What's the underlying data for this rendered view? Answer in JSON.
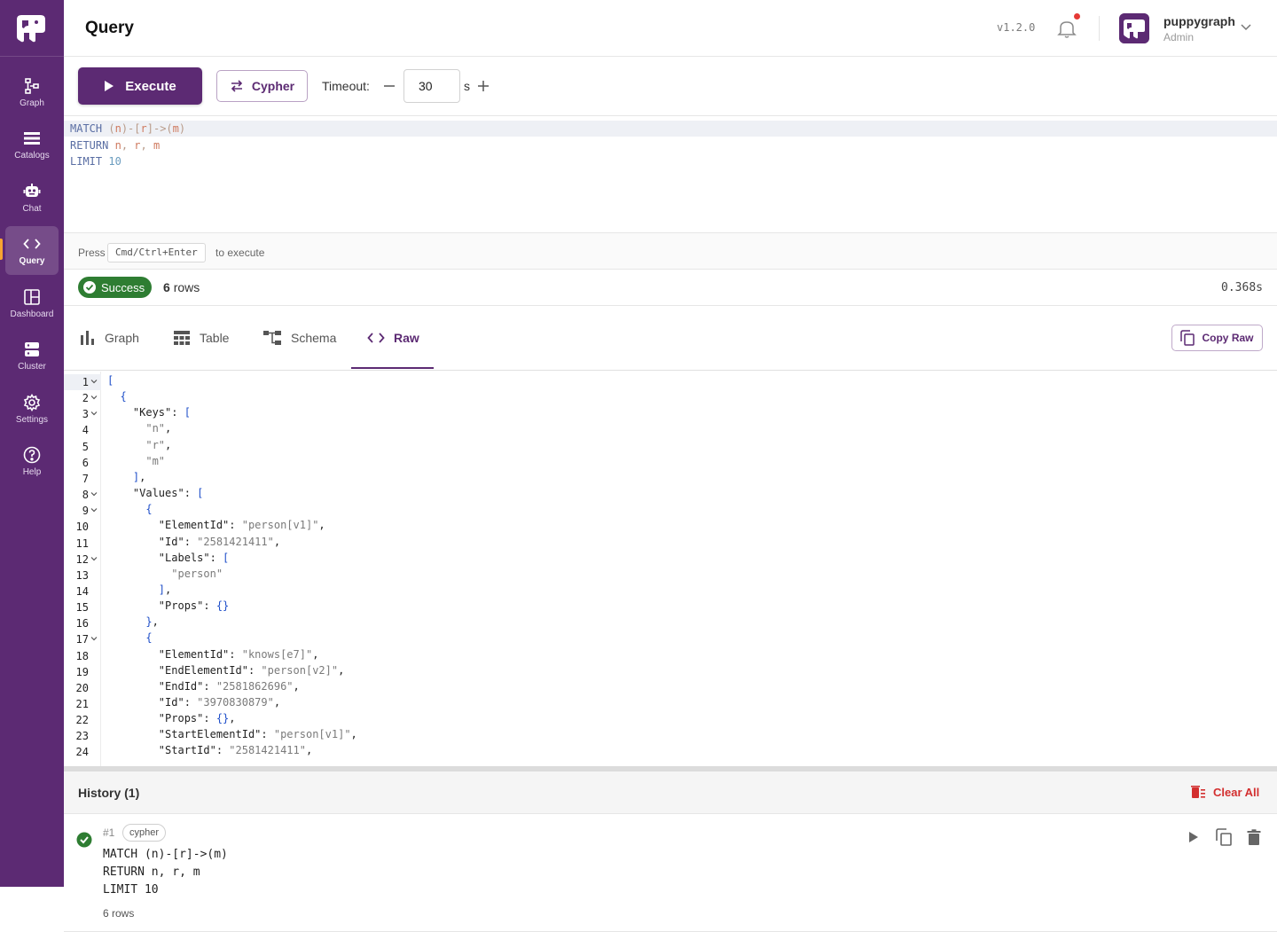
{
  "app": {
    "name": "puppygraph"
  },
  "sidebar": {
    "items": [
      {
        "label": "Graph",
        "icon": "graph-nodes-icon"
      },
      {
        "label": "Catalogs",
        "icon": "list-icon"
      },
      {
        "label": "Chat",
        "icon": "robot-icon"
      },
      {
        "label": "Query",
        "icon": "code-icon",
        "active": true
      },
      {
        "label": "Dashboard",
        "icon": "dashboard-icon"
      },
      {
        "label": "Cluster",
        "icon": "server-icon"
      },
      {
        "label": "Settings",
        "icon": "gear-icon"
      },
      {
        "label": "Help",
        "icon": "help-icon"
      }
    ]
  },
  "header": {
    "title": "Query",
    "version": "v1.2.0",
    "user": {
      "name": "puppygraph",
      "role": "Admin"
    }
  },
  "toolbar": {
    "execute_label": "Execute",
    "language_label": "Cypher",
    "timeout_label": "Timeout:",
    "timeout_value": "30",
    "timeout_unit": "s"
  },
  "editor": {
    "lines": [
      [
        {
          "t": "MATCH ",
          "c": "kw"
        },
        {
          "t": "(",
          "c": "pn"
        },
        {
          "t": "n",
          "c": "vr"
        },
        {
          "t": ")-[",
          "c": "pn"
        },
        {
          "t": "r",
          "c": "vr"
        },
        {
          "t": "]->(",
          "c": "pn"
        },
        {
          "t": "m",
          "c": "vr"
        },
        {
          "t": ")",
          "c": "pn"
        }
      ],
      [
        {
          "t": "RETURN ",
          "c": "kw"
        },
        {
          "t": "n",
          "c": "vr"
        },
        {
          "t": ", ",
          "c": "pn"
        },
        {
          "t": "r",
          "c": "vr"
        },
        {
          "t": ", ",
          "c": "pn"
        },
        {
          "t": "m",
          "c": "vr"
        }
      ],
      [
        {
          "t": "LIMIT ",
          "c": "kw"
        },
        {
          "t": "10",
          "c": "nm"
        }
      ]
    ]
  },
  "hint": {
    "pre": "Press",
    "key": "Cmd/Ctrl+Enter",
    "post": "to execute"
  },
  "status": {
    "badge": "Success",
    "rows_num": "6",
    "rows_label": "rows",
    "elapsed": "0.368s"
  },
  "tabs": [
    {
      "label": "Graph",
      "icon": "bar-chart-icon"
    },
    {
      "label": "Table",
      "icon": "table-icon"
    },
    {
      "label": "Schema",
      "icon": "schema-icon"
    },
    {
      "label": "Raw",
      "icon": "code-icon",
      "active": true
    }
  ],
  "copy_raw_label": "Copy Raw",
  "raw": {
    "lines": [
      {
        "n": "1",
        "fold": true,
        "segs": [
          [
            "br",
            "["
          ]
        ]
      },
      {
        "n": "2",
        "fold": true,
        "segs": [
          [
            "sp",
            "  "
          ],
          [
            "br",
            "{"
          ]
        ]
      },
      {
        "n": "3",
        "fold": true,
        "segs": [
          [
            "sp",
            "    "
          ],
          [
            "ky",
            "\"Keys\": "
          ],
          [
            "br",
            "["
          ]
        ]
      },
      {
        "n": "4",
        "segs": [
          [
            "sp",
            "      "
          ],
          [
            "st",
            "\"n\""
          ],
          [
            "ky",
            ","
          ]
        ]
      },
      {
        "n": "5",
        "segs": [
          [
            "sp",
            "      "
          ],
          [
            "st",
            "\"r\""
          ],
          [
            "ky",
            ","
          ]
        ]
      },
      {
        "n": "6",
        "segs": [
          [
            "sp",
            "      "
          ],
          [
            "st",
            "\"m\""
          ]
        ]
      },
      {
        "n": "7",
        "segs": [
          [
            "sp",
            "    "
          ],
          [
            "br",
            "]"
          ],
          [
            "ky",
            ","
          ]
        ]
      },
      {
        "n": "8",
        "fold": true,
        "segs": [
          [
            "sp",
            "    "
          ],
          [
            "ky",
            "\"Values\": "
          ],
          [
            "br",
            "["
          ]
        ]
      },
      {
        "n": "9",
        "fold": true,
        "segs": [
          [
            "sp",
            "      "
          ],
          [
            "br",
            "{"
          ]
        ]
      },
      {
        "n": "10",
        "segs": [
          [
            "sp",
            "        "
          ],
          [
            "ky",
            "\"ElementId\": "
          ],
          [
            "st",
            "\"person[v1]\""
          ],
          [
            "ky",
            ","
          ]
        ]
      },
      {
        "n": "11",
        "segs": [
          [
            "sp",
            "        "
          ],
          [
            "ky",
            "\"Id\": "
          ],
          [
            "st",
            "\"2581421411\""
          ],
          [
            "ky",
            ","
          ]
        ]
      },
      {
        "n": "12",
        "fold": true,
        "segs": [
          [
            "sp",
            "        "
          ],
          [
            "ky",
            "\"Labels\": "
          ],
          [
            "br",
            "["
          ]
        ]
      },
      {
        "n": "13",
        "segs": [
          [
            "sp",
            "          "
          ],
          [
            "st",
            "\"person\""
          ]
        ]
      },
      {
        "n": "14",
        "segs": [
          [
            "sp",
            "        "
          ],
          [
            "br",
            "]"
          ],
          [
            "ky",
            ","
          ]
        ]
      },
      {
        "n": "15",
        "segs": [
          [
            "sp",
            "        "
          ],
          [
            "ky",
            "\"Props\": "
          ],
          [
            "br",
            "{}"
          ]
        ]
      },
      {
        "n": "16",
        "segs": [
          [
            "sp",
            "      "
          ],
          [
            "br",
            "}"
          ],
          [
            "ky",
            ","
          ]
        ]
      },
      {
        "n": "17",
        "fold": true,
        "segs": [
          [
            "sp",
            "      "
          ],
          [
            "br",
            "{"
          ]
        ]
      },
      {
        "n": "18",
        "segs": [
          [
            "sp",
            "        "
          ],
          [
            "ky",
            "\"ElementId\": "
          ],
          [
            "st",
            "\"knows[e7]\""
          ],
          [
            "ky",
            ","
          ]
        ]
      },
      {
        "n": "19",
        "segs": [
          [
            "sp",
            "        "
          ],
          [
            "ky",
            "\"EndElementId\": "
          ],
          [
            "st",
            "\"person[v2]\""
          ],
          [
            "ky",
            ","
          ]
        ]
      },
      {
        "n": "20",
        "segs": [
          [
            "sp",
            "        "
          ],
          [
            "ky",
            "\"EndId\": "
          ],
          [
            "st",
            "\"2581862696\""
          ],
          [
            "ky",
            ","
          ]
        ]
      },
      {
        "n": "21",
        "segs": [
          [
            "sp",
            "        "
          ],
          [
            "ky",
            "\"Id\": "
          ],
          [
            "st",
            "\"3970830879\""
          ],
          [
            "ky",
            ","
          ]
        ]
      },
      {
        "n": "22",
        "segs": [
          [
            "sp",
            "        "
          ],
          [
            "ky",
            "\"Props\": "
          ],
          [
            "br",
            "{}"
          ],
          [
            "ky",
            ","
          ]
        ]
      },
      {
        "n": "23",
        "segs": [
          [
            "sp",
            "        "
          ],
          [
            "ky",
            "\"StartElementId\": "
          ],
          [
            "st",
            "\"person[v1]\""
          ],
          [
            "ky",
            ","
          ]
        ]
      },
      {
        "n": "24",
        "segs": [
          [
            "sp",
            "        "
          ],
          [
            "ky",
            "\"StartId\": "
          ],
          [
            "st",
            "\"2581421411\""
          ],
          [
            "ky",
            ","
          ]
        ]
      }
    ]
  },
  "history": {
    "title": "History (1)",
    "clear_label": "Clear All",
    "items": [
      {
        "num": "#1",
        "tag": "cypher",
        "query": [
          "MATCH (n)-[r]->(m)",
          "RETURN n, r, m",
          "LIMIT 10"
        ],
        "rows": "6 rows"
      }
    ]
  },
  "colors": {
    "brand": "#5c2a73",
    "success": "#2e7d32",
    "danger": "#d32f2f",
    "accent": "#f7a531"
  }
}
